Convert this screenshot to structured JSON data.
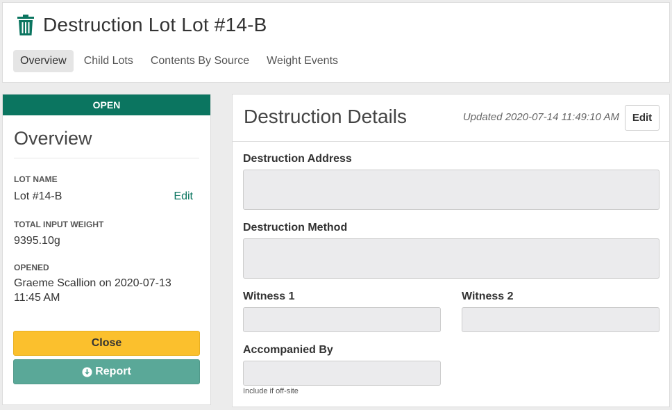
{
  "header": {
    "title": "Destruction Lot Lot #14-B",
    "icon": "trash-icon",
    "tabs": [
      {
        "label": "Overview",
        "active": true
      },
      {
        "label": "Child Lots",
        "active": false
      },
      {
        "label": "Contents By Source",
        "active": false
      },
      {
        "label": "Weight Events",
        "active": false
      }
    ]
  },
  "overview": {
    "status": "OPEN",
    "heading": "Overview",
    "lot_name_label": "LOT NAME",
    "lot_name_value": "Lot #14-B",
    "edit_label": "Edit",
    "weight_label": "TOTAL INPUT WEIGHT",
    "weight_value": "9395.10g",
    "opened_label": "OPENED",
    "opened_value": "Graeme Scallion on 2020-07-13 11:45 AM",
    "close_button": "Close",
    "report_button": "Report"
  },
  "details": {
    "title": "Destruction Details",
    "updated": "Updated 2020-07-14 11:49:10 AM",
    "edit_button": "Edit",
    "address_label": "Destruction Address",
    "address_value": "",
    "method_label": "Destruction Method",
    "method_value": "",
    "witness1_label": "Witness 1",
    "witness1_value": "",
    "witness2_label": "Witness 2",
    "witness2_value": "",
    "accompanied_label": "Accompanied By",
    "accompanied_value": "",
    "accompanied_help": "Include if off-site"
  },
  "colors": {
    "accent_green": "#0b7560",
    "close_yellow": "#fbc02d",
    "report_teal": "#5aa898"
  }
}
